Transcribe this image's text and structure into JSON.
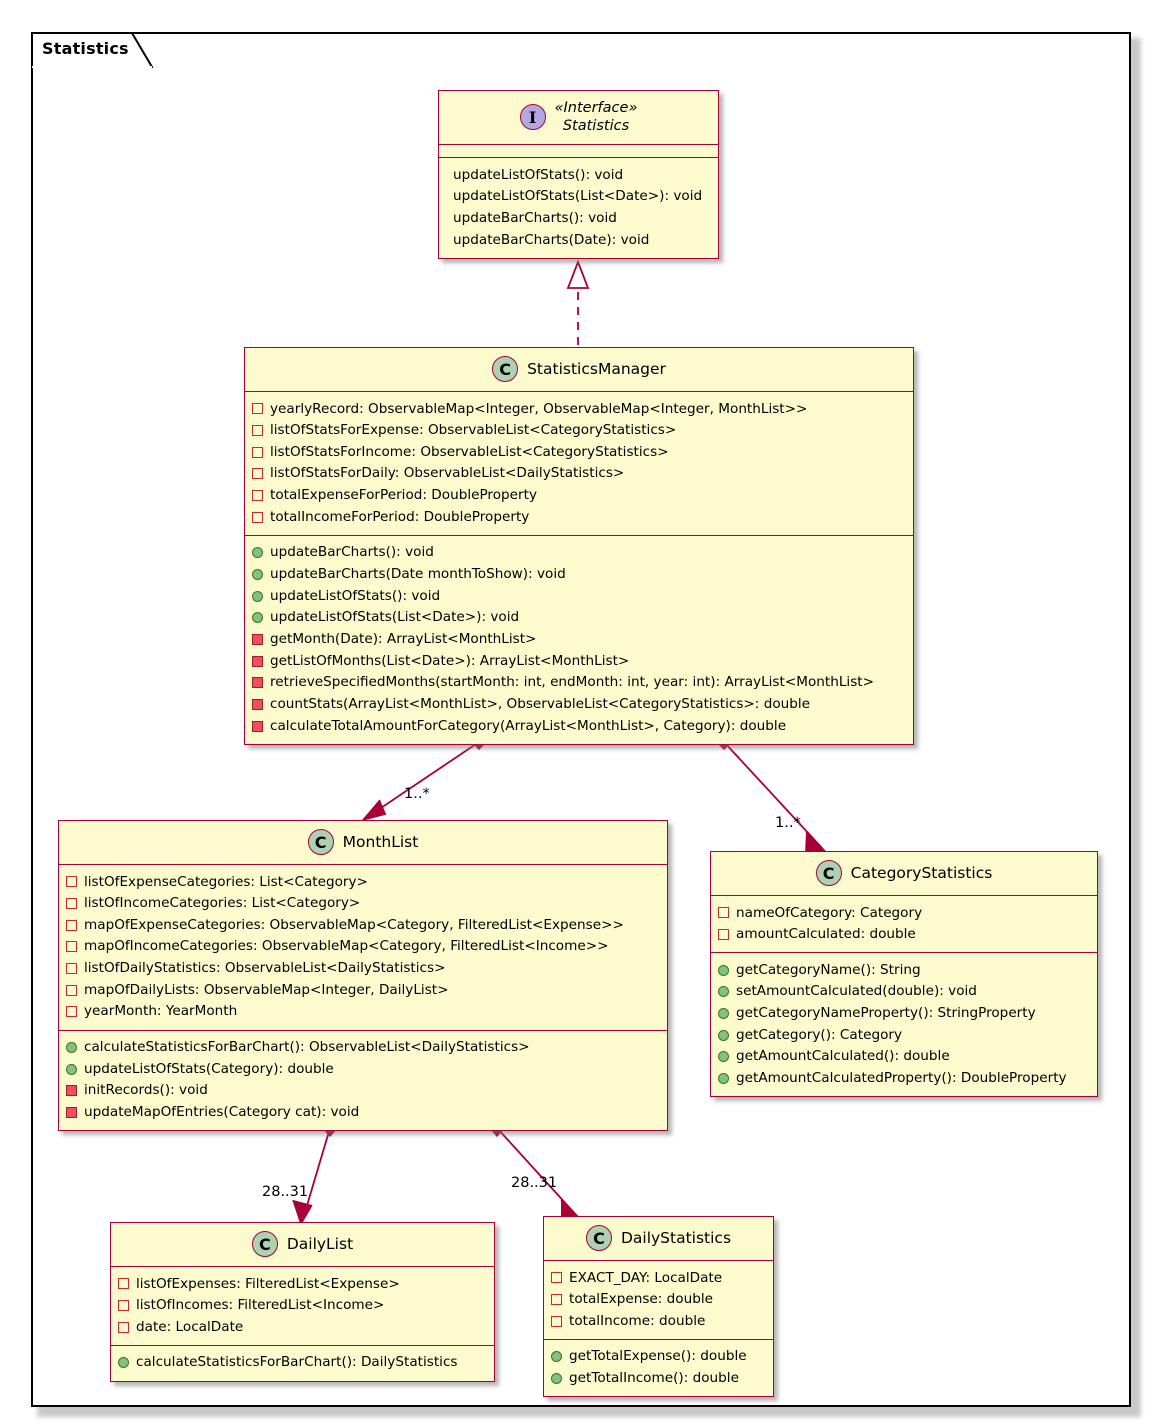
{
  "package": {
    "label": "Statistics"
  },
  "colors": {
    "box_fill": "#fbfbce",
    "box_border": "#a80036",
    "class_icon": "#add1b2",
    "interface_icon": "#b4a7e0",
    "private_marker": "#c82930",
    "private_method_marker": "#f24d5c",
    "public_method_marker": "#84bf84",
    "package_border": "#000000"
  },
  "classes": {
    "statistics": {
      "stereotype": "«Interface»",
      "name": "Statistics",
      "icon": "interface-icon",
      "icon_letter": "I",
      "attributes": [],
      "methods": [
        {
          "vis": "package",
          "text": "updateListOfStats(): void"
        },
        {
          "vis": "package",
          "text": "updateListOfStats(List<Date>): void"
        },
        {
          "vis": "package",
          "text": "updateBarCharts(): void"
        },
        {
          "vis": "package",
          "text": "updateBarCharts(Date): void"
        }
      ]
    },
    "statistics_manager": {
      "name": "StatisticsManager",
      "icon": "class-icon",
      "icon_letter": "C",
      "attributes": [
        {
          "vis": "private",
          "text": "yearlyRecord: ObservableMap<Integer, ObservableMap<Integer, MonthList>>"
        },
        {
          "vis": "private",
          "text": "listOfStatsForExpense: ObservableList<CategoryStatistics>"
        },
        {
          "vis": "private",
          "text": "listOfStatsForIncome: ObservableList<CategoryStatistics>"
        },
        {
          "vis": "private",
          "text": "listOfStatsForDaily: ObservableList<DailyStatistics>"
        },
        {
          "vis": "private",
          "text": "totalExpenseForPeriod: DoubleProperty"
        },
        {
          "vis": "private",
          "text": "totalIncomeForPeriod: DoubleProperty"
        }
      ],
      "methods": [
        {
          "vis": "public",
          "text": "updateBarCharts(): void"
        },
        {
          "vis": "public",
          "text": "updateBarCharts(Date monthToShow): void"
        },
        {
          "vis": "public",
          "text": "updateListOfStats(): void"
        },
        {
          "vis": "public",
          "text": "updateListOfStats(List<Date>): void"
        },
        {
          "vis": "private",
          "text": "getMonth(Date): ArrayList<MonthList>"
        },
        {
          "vis": "private",
          "text": "getListOfMonths(List<Date>): ArrayList<MonthList>"
        },
        {
          "vis": "private",
          "text": "retrieveSpecifiedMonths(startMonth: int, endMonth: int, year: int): ArrayList<MonthList>"
        },
        {
          "vis": "private",
          "text": "countStats(ArrayList<MonthList>, ObservableList<CategoryStatistics>: double"
        },
        {
          "vis": "private",
          "text": "calculateTotalAmountForCategory(ArrayList<MonthList>, Category): double"
        }
      ]
    },
    "month_list": {
      "name": "MonthList",
      "icon": "class-icon",
      "icon_letter": "C",
      "attributes": [
        {
          "vis": "private",
          "text": "listOfExpenseCategories: List<Category>"
        },
        {
          "vis": "private",
          "text": "listOfIncomeCategories: List<Category>"
        },
        {
          "vis": "private",
          "text": "mapOfExpenseCategories: ObservableMap<Category, FilteredList<Expense>>"
        },
        {
          "vis": "private",
          "text": "mapOfIncomeCategories: ObservableMap<Category, FilteredList<Income>>"
        },
        {
          "vis": "private",
          "text": "listOfDailyStatistics: ObservableList<DailyStatistics>"
        },
        {
          "vis": "private",
          "text": "mapOfDailyLists: ObservableMap<Integer, DailyList>"
        },
        {
          "vis": "private",
          "text": "yearMonth: YearMonth"
        }
      ],
      "methods": [
        {
          "vis": "public",
          "text": "calculateStatisticsForBarChart(): ObservableList<DailyStatistics>"
        },
        {
          "vis": "public",
          "text": "updateListOfStats(Category): double"
        },
        {
          "vis": "private",
          "text": "initRecords(): void"
        },
        {
          "vis": "private",
          "text": "updateMapOfEntries(Category cat): void"
        }
      ]
    },
    "category_statistics": {
      "name": "CategoryStatistics",
      "icon": "class-icon",
      "icon_letter": "C",
      "attributes": [
        {
          "vis": "private",
          "text": "nameOfCategory: Category"
        },
        {
          "vis": "private",
          "text": "amountCalculated: double"
        }
      ],
      "methods": [
        {
          "vis": "public",
          "text": "getCategoryName(): String"
        },
        {
          "vis": "public",
          "text": "setAmountCalculated(double): void"
        },
        {
          "vis": "public",
          "text": "getCategoryNameProperty(): StringProperty"
        },
        {
          "vis": "public",
          "text": "getCategory(): Category"
        },
        {
          "vis": "public",
          "text": "getAmountCalculated(): double"
        },
        {
          "vis": "public",
          "text": "getAmountCalculatedProperty(): DoubleProperty"
        }
      ]
    },
    "daily_list": {
      "name": "DailyList",
      "icon": "class-icon",
      "icon_letter": "C",
      "attributes": [
        {
          "vis": "private",
          "text": "listOfExpenses: FilteredList<Expense>"
        },
        {
          "vis": "private",
          "text": "listOfIncomes: FilteredList<Income>"
        },
        {
          "vis": "private",
          "text": "date: LocalDate"
        }
      ],
      "methods": [
        {
          "vis": "public",
          "text": "calculateStatisticsForBarChart(): DailyStatistics"
        }
      ]
    },
    "daily_statistics": {
      "name": "DailyStatistics",
      "icon": "class-icon",
      "icon_letter": "C",
      "attributes": [
        {
          "vis": "private",
          "text": "EXACT_DAY: LocalDate"
        },
        {
          "vis": "private",
          "text": "totalExpense: double"
        },
        {
          "vis": "private",
          "text": "totalIncome: double"
        }
      ],
      "methods": [
        {
          "vis": "public",
          "text": "getTotalExpense(): double"
        },
        {
          "vis": "public",
          "text": "getTotalIncome(): double"
        }
      ]
    }
  },
  "relationships": [
    {
      "id": "realization",
      "type": "realization",
      "from": "StatisticsManager",
      "to": "Statistics",
      "label": ""
    },
    {
      "id": "mgr-monthlist",
      "type": "composition",
      "from": "StatisticsManager",
      "to": "MonthList",
      "label": "1..*"
    },
    {
      "id": "mgr-categorystats",
      "type": "composition",
      "from": "StatisticsManager",
      "to": "CategoryStatistics",
      "label": "1..*"
    },
    {
      "id": "monthlist-dailylist",
      "type": "composition",
      "from": "MonthList",
      "to": "DailyList",
      "label": "28..31"
    },
    {
      "id": "monthlist-dailystats",
      "type": "composition",
      "from": "MonthList",
      "to": "DailyStatistics",
      "label": "28..31"
    }
  ]
}
